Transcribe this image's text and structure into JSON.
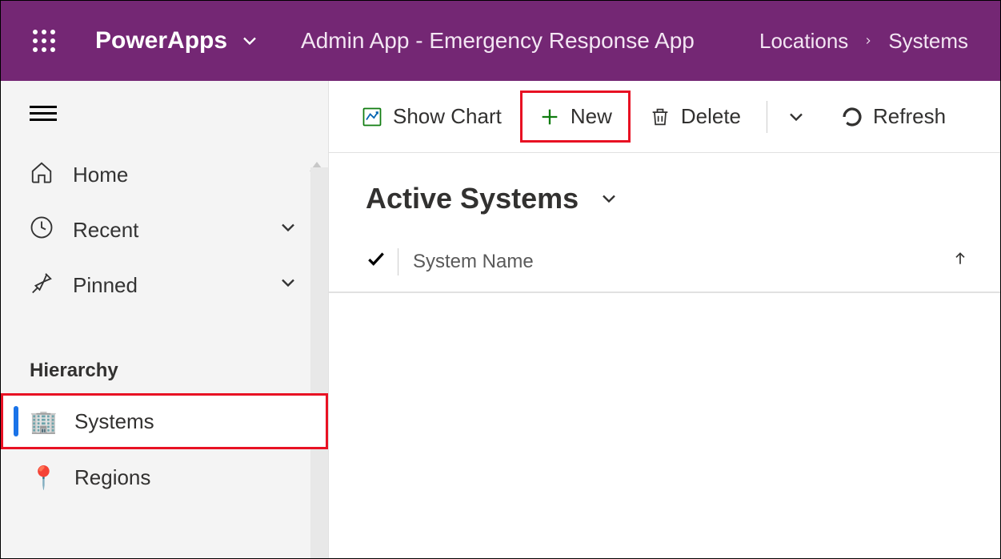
{
  "header": {
    "brand": "PowerApps",
    "app_title": "Admin App - Emergency Response App",
    "breadcrumb": [
      "Locations",
      "Systems"
    ]
  },
  "sidebar": {
    "nav": [
      {
        "key": "home",
        "label": "Home",
        "icon": "home-icon",
        "expandable": false
      },
      {
        "key": "recent",
        "label": "Recent",
        "icon": "clock-icon",
        "expandable": true
      },
      {
        "key": "pinned",
        "label": "Pinned",
        "icon": "pin-icon",
        "expandable": true
      }
    ],
    "section_title": "Hierarchy",
    "hierarchy": [
      {
        "key": "systems",
        "label": "Systems",
        "icon": "🏢",
        "active": true,
        "highlight": true
      },
      {
        "key": "regions",
        "label": "Regions",
        "icon": "📍",
        "active": false,
        "highlight": false
      }
    ]
  },
  "commandbar": {
    "show_chart": "Show Chart",
    "new": "New",
    "delete": "Delete",
    "refresh": "Refresh"
  },
  "view": {
    "title": "Active Systems",
    "columns": [
      {
        "key": "system_name",
        "label": "System Name",
        "sorted": "asc"
      }
    ],
    "rows": []
  },
  "highlight_color": "#e81123",
  "accent": "#742774"
}
